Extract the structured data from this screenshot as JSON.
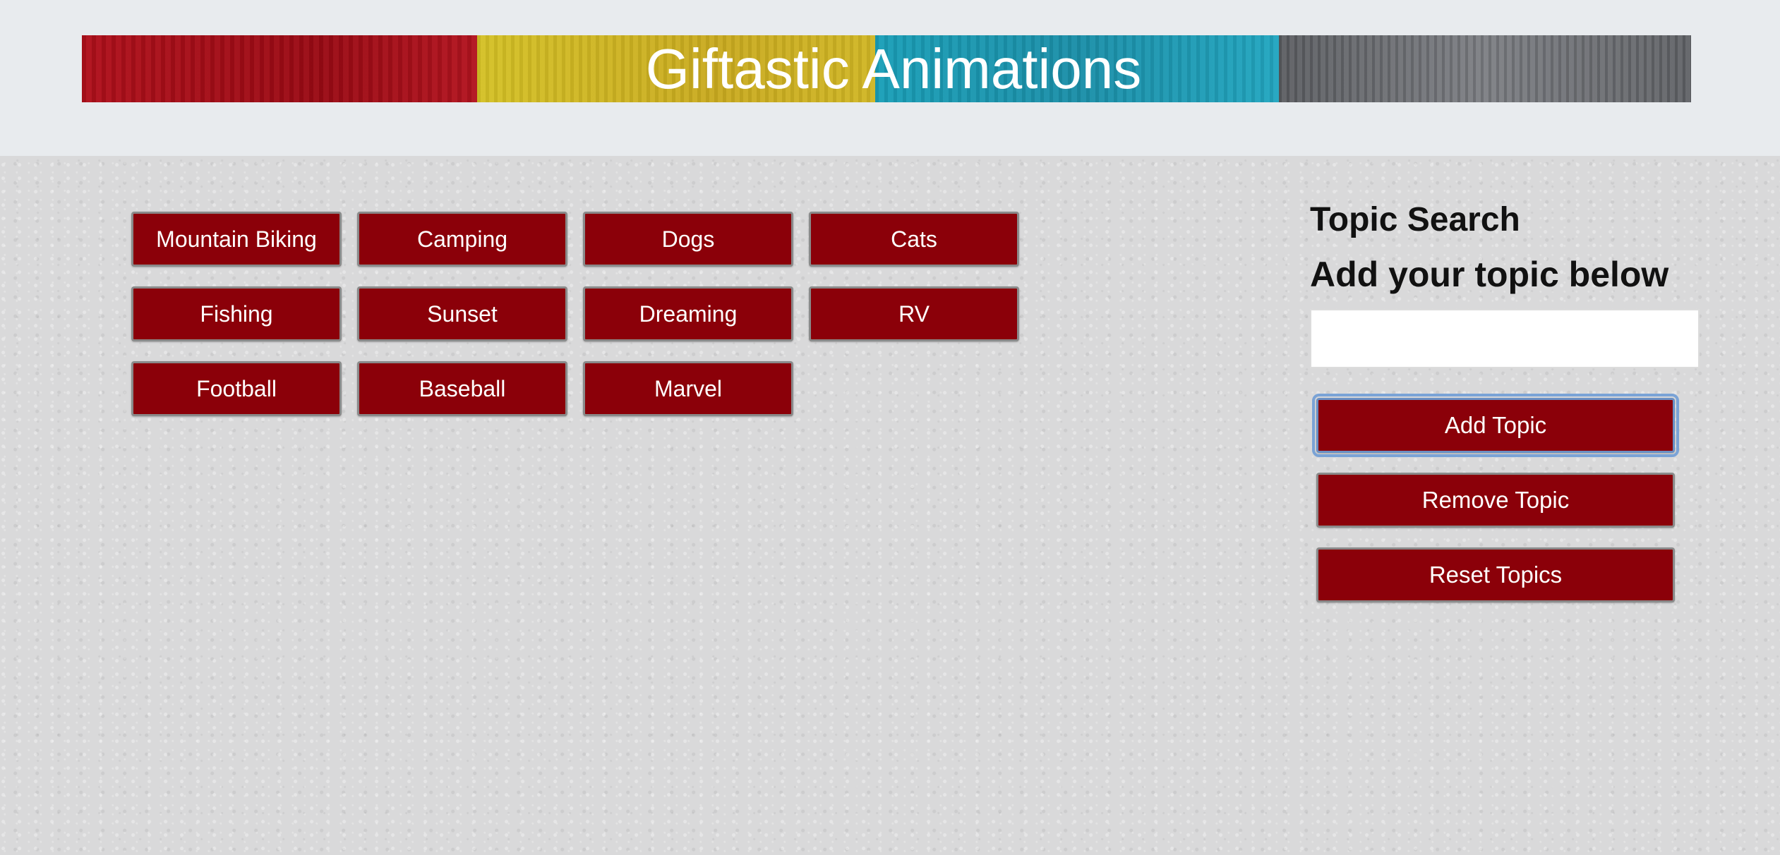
{
  "header": {
    "title": "Giftastic Animations"
  },
  "topics": [
    "Mountain Biking",
    "Camping",
    "Dogs",
    "Cats",
    "Fishing",
    "Sunset",
    "Dreaming",
    "RV",
    "Football",
    "Baseball",
    "Marvel"
  ],
  "panel": {
    "title": "Topic Search",
    "subtitle": "Add your topic below",
    "input_value": "",
    "input_placeholder": "",
    "add_label": "Add Topic",
    "remove_label": "Remove Topic",
    "reset_label": "Reset Topics"
  },
  "colors": {
    "button_bg": "#8b0009",
    "button_text": "#ffffff",
    "header_band": "#e8ebee",
    "focus_ring": "#7aa3d6"
  }
}
